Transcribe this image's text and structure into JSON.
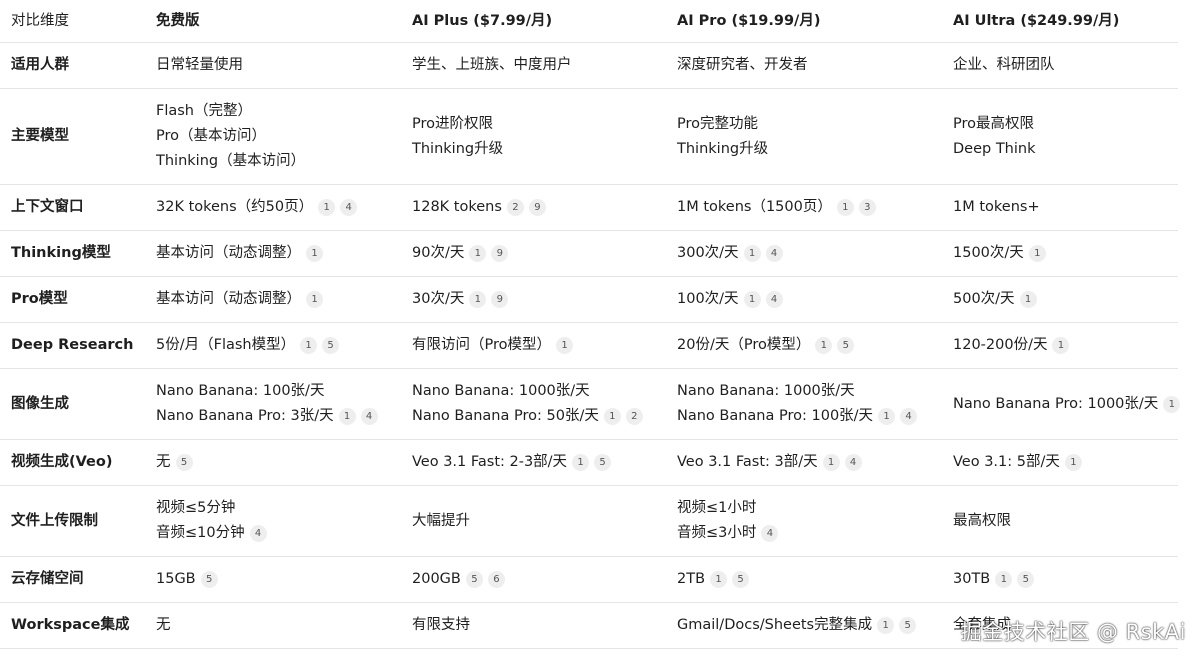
{
  "columns": [
    "对比维度",
    "免费版",
    "AI Plus ($7.99/月)",
    "AI Pro ($19.99/月)",
    "AI Ultra ($249.99/月)"
  ],
  "rows": [
    {
      "label": "适用人群",
      "cells": [
        {
          "lines": [
            "日常轻量使用"
          ],
          "cites": []
        },
        {
          "lines": [
            "学生、上班族、中度用户"
          ],
          "cites": []
        },
        {
          "lines": [
            "深度研究者、开发者"
          ],
          "cites": []
        },
        {
          "lines": [
            "企业、科研团队"
          ],
          "cites": []
        }
      ]
    },
    {
      "label": "主要模型",
      "cells": [
        {
          "lines": [
            "Flash（完整）",
            "Pro（基本访问）",
            "Thinking（基本访问）"
          ],
          "cites": []
        },
        {
          "lines": [
            "Pro进阶权限",
            "Thinking升级"
          ],
          "cites": []
        },
        {
          "lines": [
            "Pro完整功能",
            "Thinking升级"
          ],
          "cites": []
        },
        {
          "lines": [
            "Pro最高权限",
            "Deep Think"
          ],
          "cites": []
        }
      ]
    },
    {
      "label": "上下文窗口",
      "cells": [
        {
          "lines": [
            "32K tokens（约50页）"
          ],
          "cites": [
            "1",
            "4"
          ]
        },
        {
          "lines": [
            "128K tokens"
          ],
          "cites": [
            "2",
            "9"
          ]
        },
        {
          "lines": [
            "1M tokens（1500页）"
          ],
          "cites": [
            "1",
            "3"
          ]
        },
        {
          "lines": [
            "1M tokens+"
          ],
          "cites": []
        }
      ]
    },
    {
      "label": "Thinking模型",
      "cells": [
        {
          "lines": [
            "基本访问（动态调整）"
          ],
          "cites": [
            "1"
          ]
        },
        {
          "lines": [
            "90次/天"
          ],
          "cites": [
            "1",
            "9"
          ]
        },
        {
          "lines": [
            "300次/天"
          ],
          "cites": [
            "1",
            "4"
          ]
        },
        {
          "lines": [
            "1500次/天"
          ],
          "cites": [
            "1"
          ]
        }
      ]
    },
    {
      "label": "Pro模型",
      "cells": [
        {
          "lines": [
            "基本访问（动态调整）"
          ],
          "cites": [
            "1"
          ]
        },
        {
          "lines": [
            "30次/天"
          ],
          "cites": [
            "1",
            "9"
          ]
        },
        {
          "lines": [
            "100次/天"
          ],
          "cites": [
            "1",
            "4"
          ]
        },
        {
          "lines": [
            "500次/天"
          ],
          "cites": [
            "1"
          ]
        }
      ]
    },
    {
      "label": "Deep Research",
      "cells": [
        {
          "lines": [
            "5份/月（Flash模型）"
          ],
          "cites": [
            "1",
            "5"
          ]
        },
        {
          "lines": [
            "有限访问（Pro模型）"
          ],
          "cites": [
            "1"
          ]
        },
        {
          "lines": [
            "20份/天（Pro模型）"
          ],
          "cites": [
            "1",
            "5"
          ]
        },
        {
          "lines": [
            "120-200份/天"
          ],
          "cites": [
            "1"
          ]
        }
      ]
    },
    {
      "label": "图像生成",
      "cells": [
        {
          "lines": [
            "Nano Banana: 100张/天",
            "Nano Banana Pro: 3张/天"
          ],
          "cites": [
            "1",
            "4"
          ]
        },
        {
          "lines": [
            "Nano Banana: 1000张/天",
            "Nano Banana Pro: 50张/天"
          ],
          "cites": [
            "1",
            "2"
          ]
        },
        {
          "lines": [
            "Nano Banana: 1000张/天",
            "Nano Banana Pro: 100张/天"
          ],
          "cites": [
            "1",
            "4"
          ]
        },
        {
          "lines": [
            "Nano Banana Pro: 1000张/天"
          ],
          "cites": [
            "1"
          ]
        }
      ]
    },
    {
      "label": "视频生成(Veo)",
      "cells": [
        {
          "lines": [
            "无"
          ],
          "cites": [
            "5"
          ]
        },
        {
          "lines": [
            "Veo 3.1 Fast: 2-3部/天"
          ],
          "cites": [
            "1",
            "5"
          ]
        },
        {
          "lines": [
            "Veo 3.1 Fast: 3部/天"
          ],
          "cites": [
            "1",
            "4"
          ]
        },
        {
          "lines": [
            "Veo 3.1: 5部/天"
          ],
          "cites": [
            "1"
          ]
        }
      ]
    },
    {
      "label": "文件上传限制",
      "cells": [
        {
          "lines": [
            "视频≤5分钟",
            "音频≤10分钟"
          ],
          "cites": [
            "4"
          ]
        },
        {
          "lines": [
            "大幅提升"
          ],
          "cites": []
        },
        {
          "lines": [
            "视频≤1小时",
            "音频≤3小时"
          ],
          "cites": [
            "4"
          ]
        },
        {
          "lines": [
            "最高权限"
          ],
          "cites": []
        }
      ]
    },
    {
      "label": "云存储空间",
      "cells": [
        {
          "lines": [
            "15GB"
          ],
          "cites": [
            "5"
          ]
        },
        {
          "lines": [
            "200GB"
          ],
          "cites": [
            "5",
            "6"
          ]
        },
        {
          "lines": [
            "2TB"
          ],
          "cites": [
            "1",
            "5"
          ]
        },
        {
          "lines": [
            "30TB"
          ],
          "cites": [
            "1",
            "5"
          ]
        }
      ]
    },
    {
      "label": "Workspace集成",
      "cells": [
        {
          "lines": [
            "无"
          ],
          "cites": []
        },
        {
          "lines": [
            "有限支持"
          ],
          "cites": []
        },
        {
          "lines": [
            "Gmail/Docs/Sheets完整集成"
          ],
          "cites": [
            "1",
            "5"
          ]
        },
        {
          "lines": [
            "全套集成"
          ],
          "cites": []
        }
      ]
    }
  ],
  "watermark": "掘金技术社区 @ RskAi"
}
